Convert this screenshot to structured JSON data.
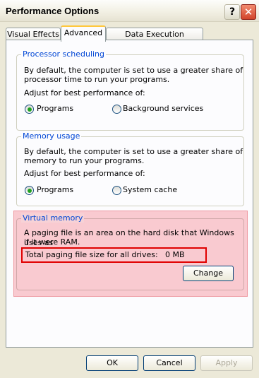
{
  "window": {
    "title": "Performance Options",
    "help_label": "?",
    "close_label": "✕"
  },
  "tabs": [
    {
      "label": "Visual Effects"
    },
    {
      "label": "Advanced"
    },
    {
      "label": "Data Execution Prevention"
    }
  ],
  "processor": {
    "legend": "Processor scheduling",
    "desc_line1": "By default, the computer is set to use a greater share of",
    "desc_line2": "processor time to run your programs.",
    "adjust": "Adjust for best performance of:",
    "option1": "Programs",
    "option2": "Background services",
    "selected": "Programs"
  },
  "memory": {
    "legend": "Memory usage",
    "desc_line1": "By default, the computer is set to use a greater share of",
    "desc_line2": "memory to run your programs.",
    "adjust": "Adjust for best performance of:",
    "option1": "Programs",
    "option2": "System cache",
    "selected": "Programs"
  },
  "virtual": {
    "legend": "Virtual memory",
    "desc_line1": "A paging file is an area on the hard disk that Windows uses as",
    "desc_line2": "if it were RAM.",
    "total_label": "Total paging file size for all drives:",
    "total_value": "0 MB",
    "change_label": "Change"
  },
  "footer": {
    "ok": "OK",
    "cancel": "Cancel",
    "apply": "Apply"
  },
  "colors": {
    "legend": "#0046d5",
    "radio_selected": "#21a121",
    "highlight": "#f5a0aa",
    "outline": "#e00000"
  }
}
